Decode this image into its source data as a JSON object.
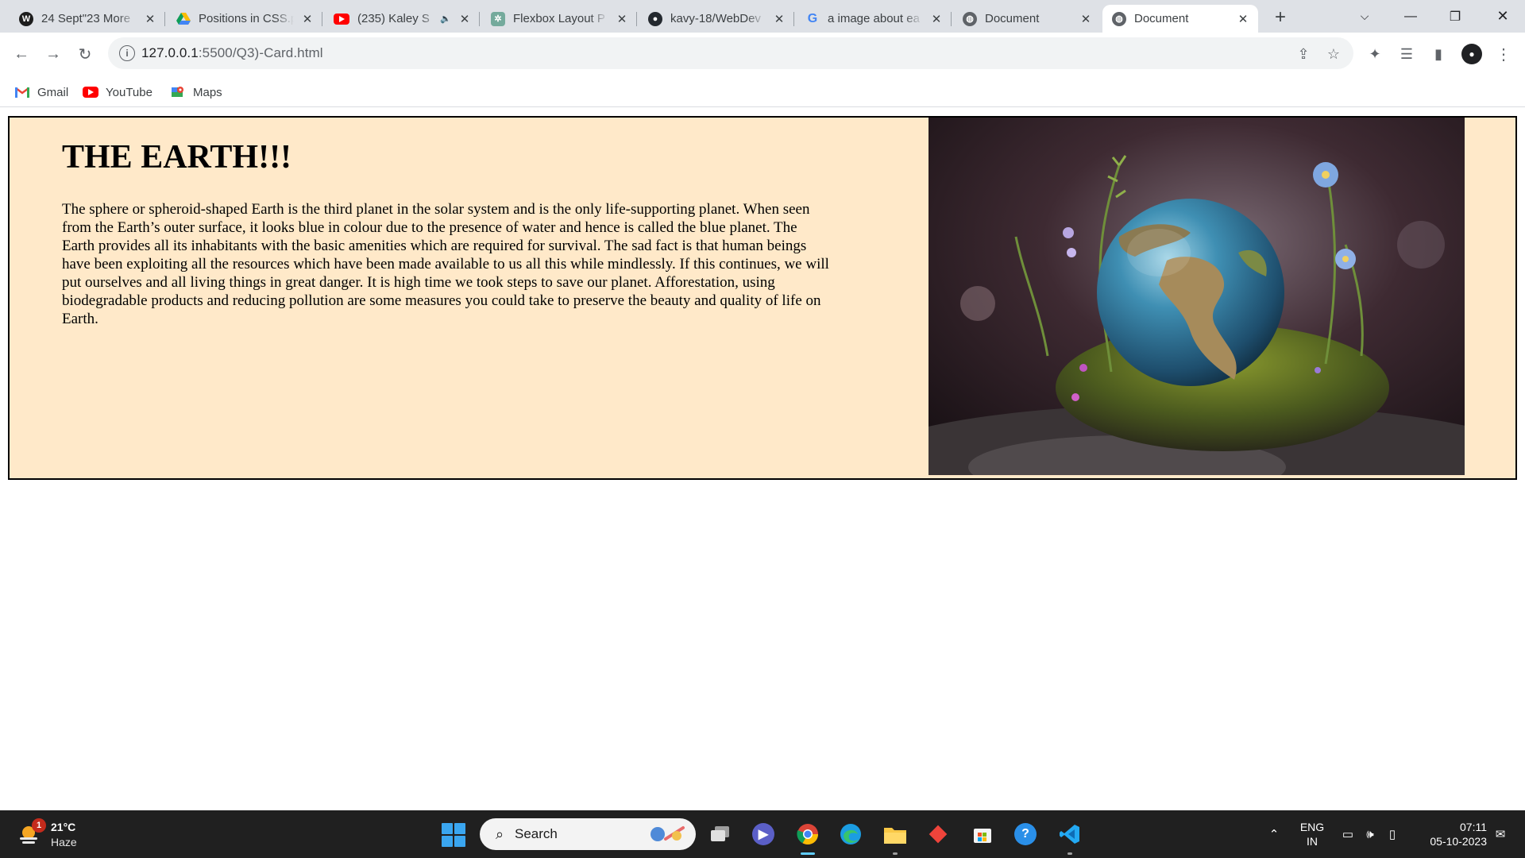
{
  "browser": {
    "tabs": [
      {
        "title": "24 Sept\"23 More",
        "icon": "wordpress-icon",
        "active": false
      },
      {
        "title": "Positions in CSS.p",
        "icon": "google-drive-icon",
        "active": false
      },
      {
        "title": "(235) Kaley S",
        "icon": "youtube-icon",
        "active": false,
        "muted_indicator": "🔈"
      },
      {
        "title": "Flexbox Layout P",
        "icon": "chatgpt-icon",
        "active": false
      },
      {
        "title": "kavy-18/WebDev",
        "icon": "github-icon",
        "active": false
      },
      {
        "title": "a image about ea",
        "icon": "google-icon",
        "active": false
      },
      {
        "title": "Document",
        "icon": "globe-icon",
        "active": false
      },
      {
        "title": "Document",
        "icon": "globe-icon",
        "active": true
      }
    ],
    "url_host": "127.0.0.1",
    "url_rest": ":5500/Q3)-Card.html",
    "bookmarks": [
      {
        "label": "Gmail",
        "icon": "gmail-icon"
      },
      {
        "label": "YouTube",
        "icon": "youtube-icon"
      },
      {
        "label": "Maps",
        "icon": "maps-icon"
      }
    ]
  },
  "page": {
    "heading": "THE EARTH!!!",
    "paragraph": "The sphere or spheroid-shaped Earth is the third planet in the solar system and is the only life-supporting planet. When seen from the Earth’s outer surface, it looks blue in colour due to the presence of water and hence is called the blue planet. The Earth provides all its inhabitants with the basic amenities which are required for survival. The sad fact is that human beings have been exploiting all the resources which have been made available to us all this while mindlessly. If this continues, we will put ourselves and all living things in great danger. It is high time we took steps to save our planet. Afforestation, using biodegradable products and reducing pollution are some measures you could take to preserve the beauty and quality of life on Earth.",
    "card_background": "#ffe9c9"
  },
  "taskbar": {
    "weather_badge": "1",
    "temperature": "21°C",
    "condition": "Haze",
    "search_label": "Search",
    "language_line1": "ENG",
    "language_line2": "IN",
    "time": "07:11",
    "date": "05-10-2023"
  }
}
